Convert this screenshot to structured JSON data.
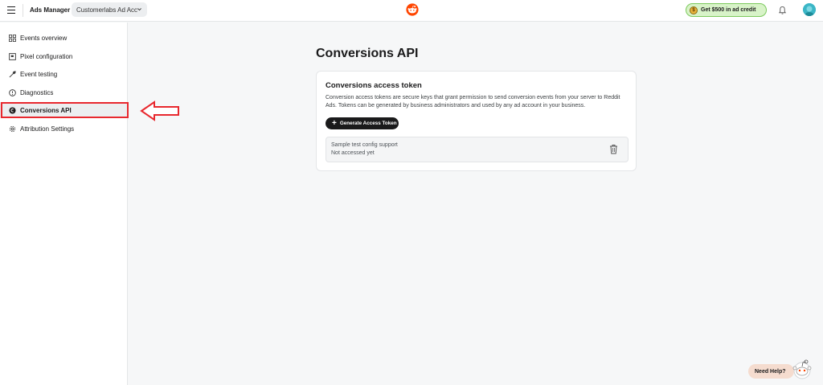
{
  "header": {
    "brand": "Ads Manager",
    "account": "Customerlabs Ad Acc",
    "credit_label": "Get $500 in ad credit",
    "credit_coin": "$"
  },
  "sidebar": {
    "items": [
      {
        "label": "Events overview",
        "icon": "grid-icon"
      },
      {
        "label": "Pixel configuration",
        "icon": "pixel-icon"
      },
      {
        "label": "Event testing",
        "icon": "wrench-icon"
      },
      {
        "label": "Diagnostics",
        "icon": "info-icon"
      },
      {
        "label": "Conversions API",
        "icon": "capi-icon",
        "active": true
      },
      {
        "label": "Attribution Settings",
        "icon": "gear-icon"
      }
    ]
  },
  "main": {
    "title": "Conversions API",
    "card": {
      "title": "Conversions access token",
      "description": "Conversion access tokens are secure keys that grant permission to send conversion events from your server to Reddit Ads. Tokens can be generated by business administrators and used by any ad account in your business.",
      "button_label": "Generate Access Token",
      "token": {
        "name": "Sample test config support",
        "status": "Not accessed yet"
      }
    }
  },
  "help": {
    "label": "Need Help?"
  },
  "colors": {
    "highlight": "#e8282e",
    "accent": "#ff4500",
    "credit_bg": "#d8f3c8"
  }
}
